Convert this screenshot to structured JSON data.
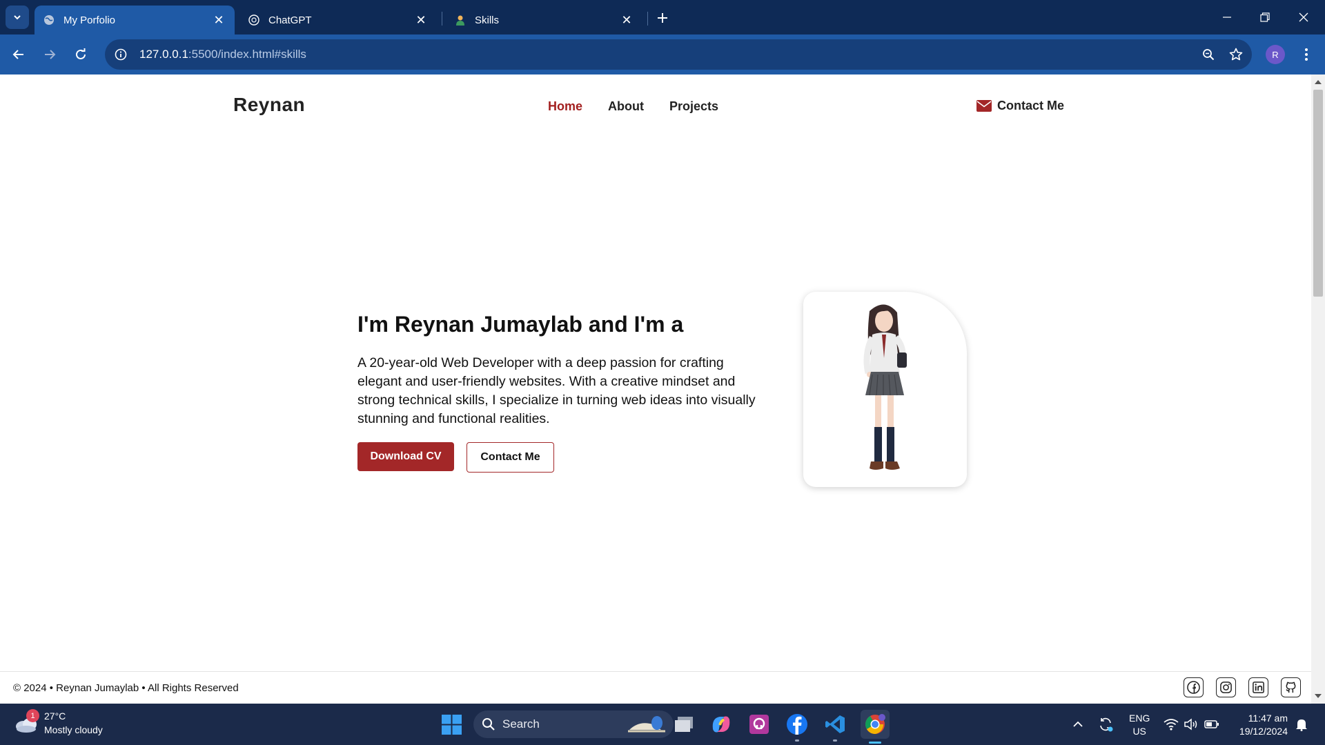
{
  "browser": {
    "tabs": [
      {
        "title": "My Porfolio",
        "icon": "globe-icon",
        "active": true
      },
      {
        "title": "ChatGPT",
        "icon": "chatgpt-icon",
        "active": false
      },
      {
        "title": "Skills",
        "icon": "person-icon",
        "active": false
      }
    ],
    "url_host": "127.0.0.1",
    "url_path": ":5500/index.html#skills",
    "profile_initial": "R"
  },
  "site": {
    "logo": "Reynan",
    "nav": [
      {
        "label": "Home",
        "active": true
      },
      {
        "label": "About",
        "active": false
      },
      {
        "label": "Projects",
        "active": false
      }
    ],
    "contact_link": "Contact Me",
    "hero": {
      "title": "I'm Reynan Jumaylab and I'm a",
      "description": "A 20-year-old Web Developer with a deep passion for crafting elegant and user-friendly websites. With a creative mindset and strong technical skills, I specialize in turning web ideas into visually stunning and functional realities.",
      "primary_button": "Download CV",
      "secondary_button": "Contact Me"
    },
    "footer": {
      "copyright": "© 2024 • Reynan Jumaylab • All Rights Reserved",
      "socials": [
        "facebook-icon",
        "instagram-icon",
        "linkedin-icon",
        "github-icon"
      ]
    },
    "accent_color": "#a32728"
  },
  "taskbar": {
    "weather_temp": "27°C",
    "weather_desc": "Mostly cloudy",
    "weather_badge": "1",
    "search_placeholder": "Search",
    "lang_line1": "ENG",
    "lang_line2": "US",
    "time": "11:47 am",
    "date": "19/12/2024"
  }
}
